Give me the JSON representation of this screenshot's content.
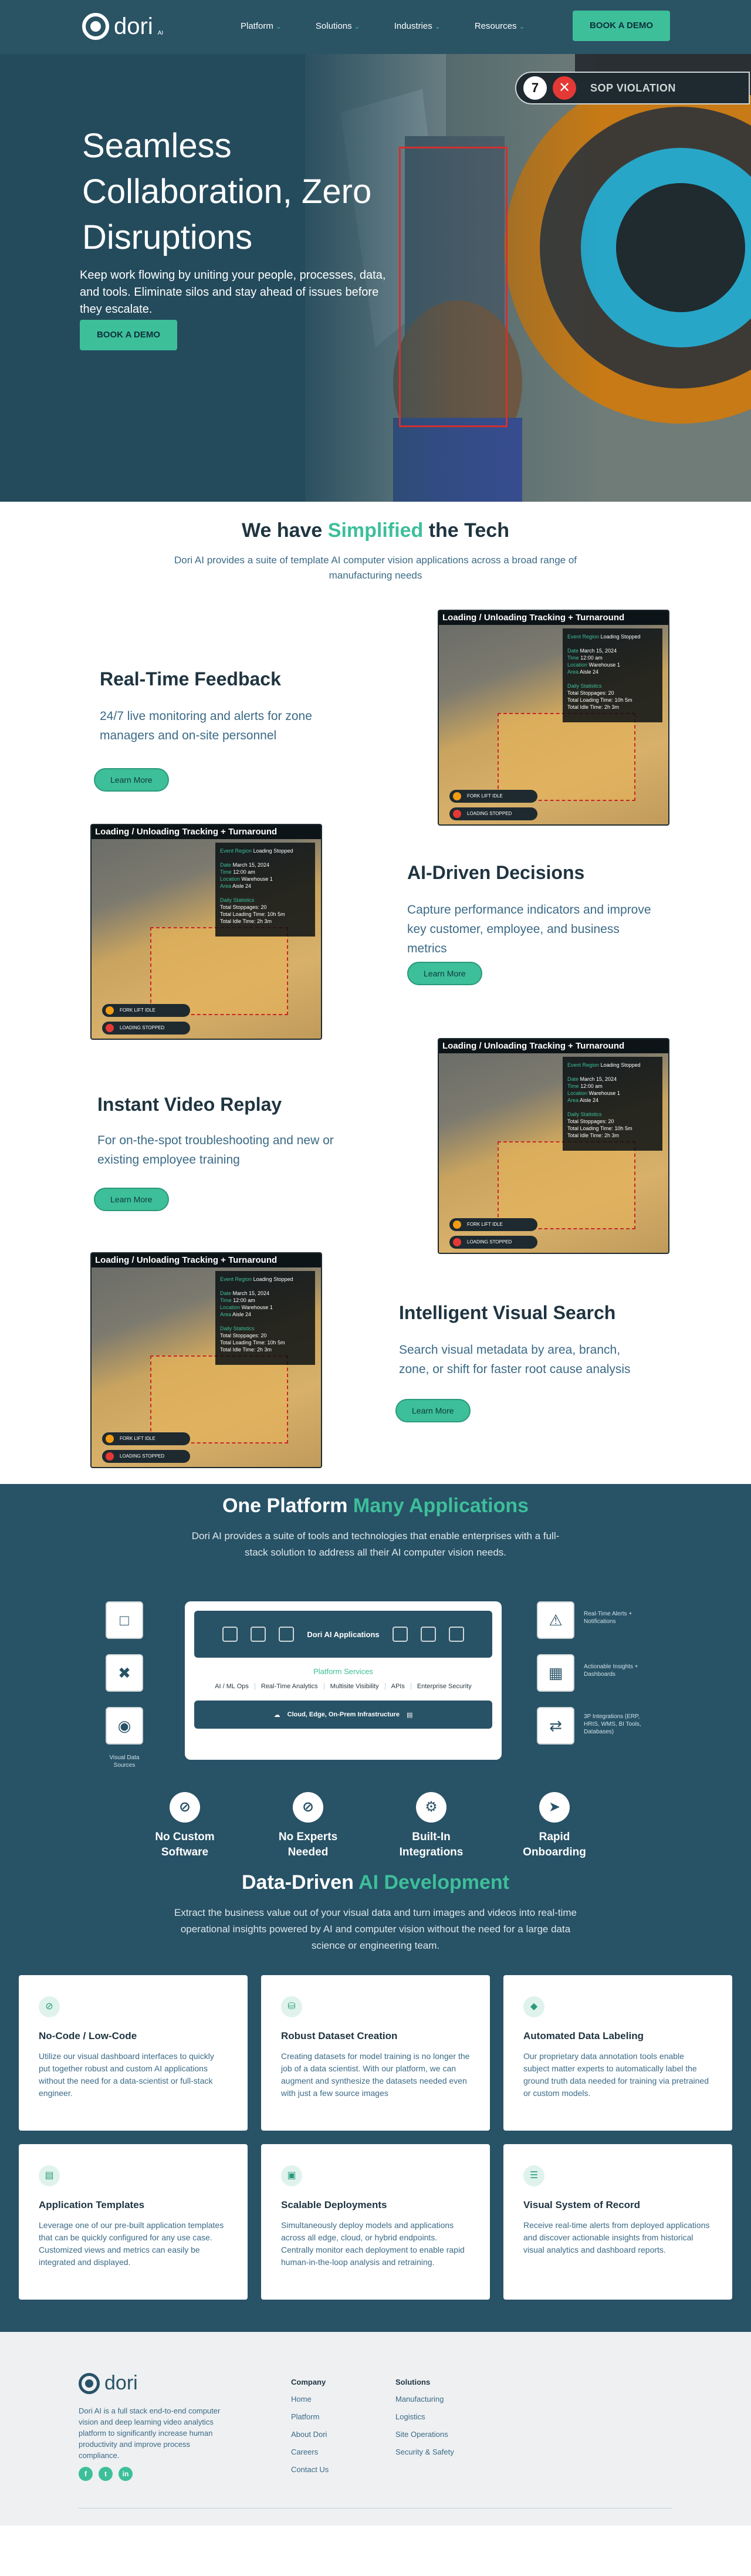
{
  "nav": {
    "logo_text": "dori",
    "logo_suffix": "AI",
    "links": [
      "Platform",
      "Solutions",
      "Industries",
      "Resources"
    ],
    "cta": "BOOK A DEMO"
  },
  "hero": {
    "title": "Seamless Collaboration, Zero Disruptions",
    "body": "Keep work flowing by uniting your people, processes, data, and tools. Eliminate silos and stay ahead of issues before they escalate.",
    "cta": "BOOK A DEMO",
    "violation_count": "7",
    "violation_label": "SOP VIOLATION"
  },
  "simplified": {
    "title_a": "We have ",
    "title_b": "Simplified",
    "title_c": " the Tech",
    "subtitle": "Dori AI provides a suite of template AI computer vision applications across a broad range of manufacturing needs"
  },
  "card": {
    "header": "Loading / Unloading Tracking + Turnaround",
    "event_label": "Event Region",
    "event_value": "Loading Stopped",
    "rows": [
      [
        "Date",
        "March 15, 2024"
      ],
      [
        "Time",
        "12:00 am"
      ],
      [
        "Location",
        "Warehouse 1"
      ],
      [
        "Area",
        "Aisle 24"
      ]
    ],
    "stats_label": "Daily Statistics",
    "stats": [
      "Total Stoppages: 20",
      "Total Loading Time: 10h 5m",
      "Total Idle Time: 2h 3m"
    ],
    "tag1": "FORK LIFT IDLE",
    "tag2": "LOADING STOPPED"
  },
  "features": [
    {
      "title": "Real-Time Feedback",
      "body": "24/7 live monitoring and alerts for zone managers and on-site personnel",
      "cta": "Learn More"
    },
    {
      "title": "AI-Driven Decisions",
      "body": "Capture performance indicators and improve key customer, employee, and business metrics",
      "cta": "Learn More"
    },
    {
      "title": "Instant Video Replay",
      "body": "For on-the-spot troubleshooting and new or existing employee training",
      "cta": "Learn More"
    },
    {
      "title": "Intelligent Visual Search",
      "body": "Search visual metadata by area, branch, zone, or shift for faster root cause analysis",
      "cta": "Learn More"
    }
  ],
  "platform": {
    "title_a": "One Platform ",
    "title_b": "Many Applications",
    "subtitle": "Dori AI provides a suite of tools and technologies that enable enterprises with a full-stack solution to address all their AI computer vision needs.",
    "hub_title": "Dori AI Applications",
    "services_label": "Platform Services",
    "services": [
      "AI / ML Ops",
      "Real-Time Analytics",
      "Multisite Visibility",
      "APIs",
      "Enterprise Security"
    ],
    "infra": "Cloud, Edge, On-Prem Infrastructure",
    "sources_label": "Visual Data Sources",
    "outputs": [
      "Real-Time Alerts + Notifications",
      "Actionable Insights + Dashboards",
      "3P Integrations (ERP, HRIS, WMS, BI Tools, Databases)"
    ],
    "benefits": [
      "No Custom Software",
      "No Experts Needed",
      "Built-In Integrations",
      "Rapid Onboarding"
    ]
  },
  "datadriven": {
    "title_a": "Data-Driven ",
    "title_b": "AI Development",
    "subtitle": "Extract the business value out of your visual data and turn images and videos into real-time operational insights powered by AI and computer vision without the need for a large data science or engineering team.",
    "tiles": [
      {
        "title": "No-Code / Low-Code",
        "body": "Utilize our visual dashboard interfaces to quickly put together robust and custom AI applications without the need for a data-scientist or full-stack engineer.",
        "icon": "ban-icon"
      },
      {
        "title": "Robust Dataset Creation",
        "body": "Creating datasets for model training is no longer the job of a data scientist. With our platform, we can augment and synthesize the datasets needed even with just a few source images",
        "icon": "database-icon"
      },
      {
        "title": "Automated Data Labeling",
        "body": "Our proprietary data annotation tools enable subject matter experts to automatically label the ground truth data needed for training via pretrained or custom models.",
        "icon": "tag-icon"
      },
      {
        "title": "Application Templates",
        "body": "Leverage one of our pre-built application templates that can be quickly configured for any use case. Customized views and metrics can easily be integrated and displayed.",
        "icon": "template-icon"
      },
      {
        "title": "Scalable Deployments",
        "body": "Simultaneously deploy models and applications across all edge, cloud, or hybrid endpoints. Centrally monitor each deployment to enable rapid human-in-the-loop analysis and retraining.",
        "icon": "truck-icon"
      },
      {
        "title": "Visual System of Record",
        "body": "Receive real-time alerts from deployed applications and discover actionable insights from historical visual analytics and dashboard reports.",
        "icon": "layers-icon"
      }
    ]
  },
  "footer": {
    "description": "Dori AI is a full stack end-to-end computer vision and deep learning video analytics platform to significantly increase human productivity and improve process compliance.",
    "social": [
      "f",
      "t",
      "in"
    ],
    "company_title": "Company",
    "company": [
      "Home",
      "Platform",
      "About Dori",
      "Careers",
      "Contact Us"
    ],
    "solutions_title": "Solutions",
    "solutions": [
      "Manufacturing",
      "Logistics",
      "Site Operations",
      "Security & Safety"
    ]
  }
}
